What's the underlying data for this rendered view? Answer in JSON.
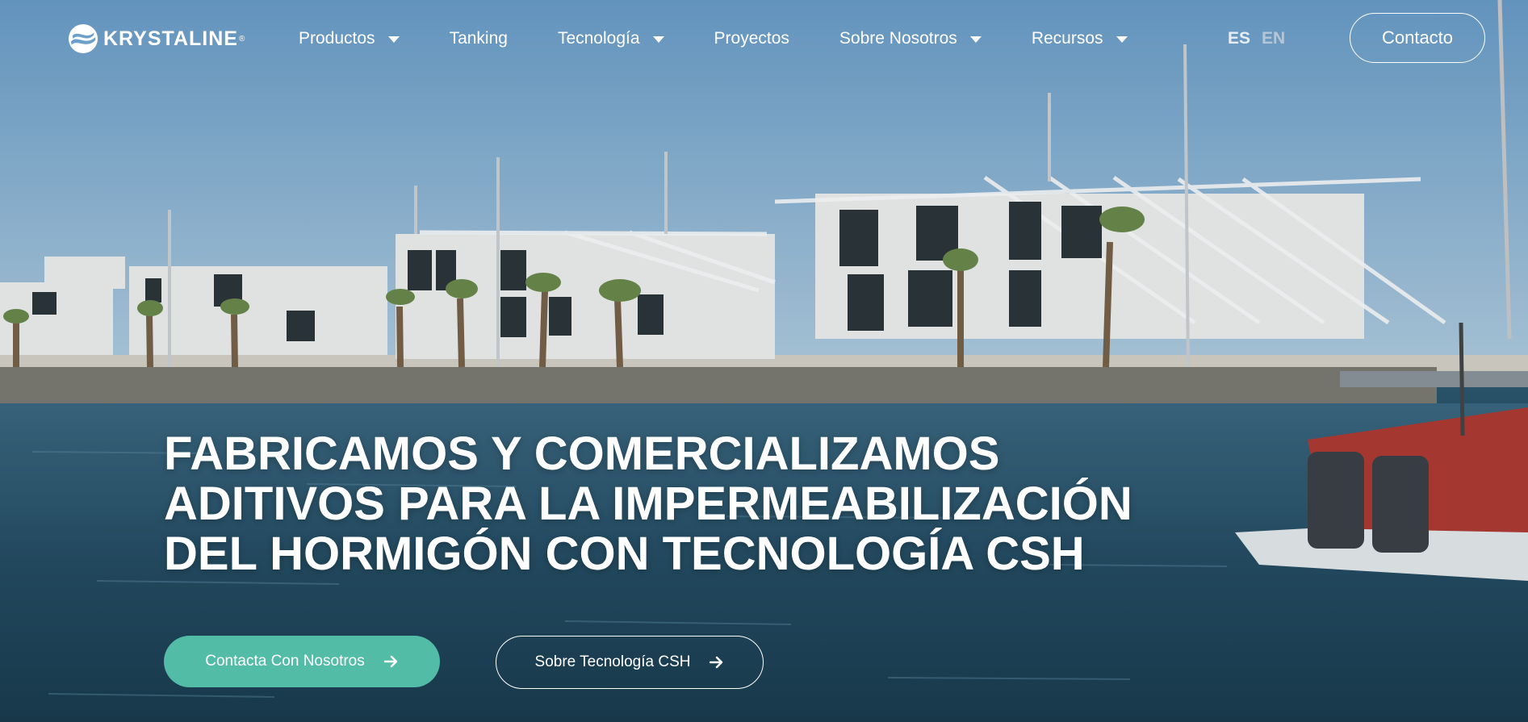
{
  "brand": {
    "name": "KRYSTALINE",
    "registered_mark": "®",
    "logo_icon": "wave-circle-logo-icon"
  },
  "nav": {
    "items": [
      {
        "label": "Productos",
        "has_dropdown": true
      },
      {
        "label": "Tanking",
        "has_dropdown": false
      },
      {
        "label": "Tecnología",
        "has_dropdown": true
      },
      {
        "label": "Proyectos",
        "has_dropdown": false
      },
      {
        "label": "Sobre Nosotros",
        "has_dropdown": true
      },
      {
        "label": "Recursos",
        "has_dropdown": true
      }
    ],
    "languages": {
      "active": "ES",
      "other": "EN"
    },
    "contact_label": "Contacto"
  },
  "hero": {
    "headline": "FABRICAMOS Y COMERCIALIZAMOS ADITIVOS PARA LA IMPERMEABILIZACIÓN DEL HORMIGÓN CON TECNOLOGÍA CSH",
    "cta_primary": "Contacta Con Nosotros",
    "cta_secondary": "Sobre Tecnología CSH"
  },
  "colors": {
    "accent": "#52bca7",
    "text": "#ffffff"
  }
}
